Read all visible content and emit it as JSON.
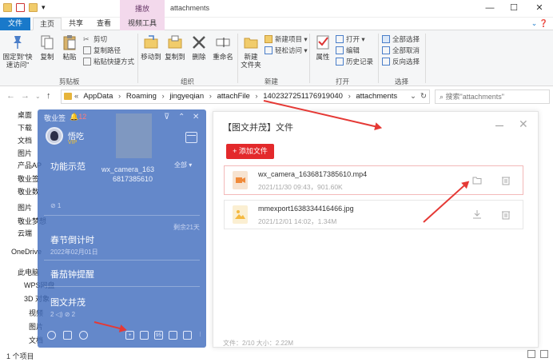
{
  "window": {
    "title": "attachments",
    "tools_header": "播放",
    "controls": [
      "—",
      "☐",
      "✕"
    ]
  },
  "ribbon_tabs": [
    "文件",
    "主页",
    "共享",
    "查看",
    "视频工具"
  ],
  "ribbon": {
    "clipboard": {
      "pin": "固定到\"快速访问\"",
      "copy": "复制",
      "paste": "粘贴",
      "cut": "剪切",
      "copy_path": "复制路径",
      "paste_shortcut": "粘贴快捷方式",
      "label": "剪贴板"
    },
    "organize": {
      "move_to": "移动到",
      "copy_to": "复制到",
      "delete": "删除",
      "rename": "重命名",
      "label": "组织"
    },
    "new": {
      "new_folder": "新建\n文件夹",
      "new_item": "新建项目 ▾",
      "easy_access": "轻松访问 ▾",
      "label": "新建"
    },
    "open": {
      "properties": "属性",
      "open": "打开 ▾",
      "edit": "编辑",
      "history": "历史记录",
      "label": "打开"
    },
    "select": {
      "select_all": "全部选择",
      "select_none": "全部取消",
      "invert": "反向选择",
      "label": "选择"
    }
  },
  "address": {
    "crumbs": [
      "«",
      "AppData",
      "›",
      "Roaming",
      "›",
      "jingyeqian",
      "›",
      "attachFile",
      "›",
      "1402327251176919040",
      "›",
      "attachments"
    ],
    "search_placeholder": "搜索\"attachments\""
  },
  "navpane": [
    "桌面",
    "下载",
    "文档",
    "图片",
    "产品AP",
    "敬业签",
    "敬业数",
    "图片",
    "敬业梦想",
    "云端",
    "OneDrive",
    "此电脑",
    "WPS网盘",
    "3D 对象",
    "视频",
    "图片",
    "文档"
  ],
  "statusbar": {
    "count": "1 个项目"
  },
  "sticky": {
    "app_name": "敬业签",
    "count": "12",
    "user": "悟吃",
    "vip": "VIP",
    "filter": "全部 ▾",
    "thumb_caption_1": "wx_camera_163",
    "thumb_caption_2": "6817385610",
    "notes": [
      {
        "title": "功能示范",
        "meta": "",
        "extra": ""
      },
      {
        "title": "",
        "meta": "⊘ 1",
        "extra": ""
      },
      {
        "title": "春节倒计时",
        "meta": "2022年02月01日",
        "extra": "剩余21天"
      },
      {
        "title": "番茄钟提醒",
        "meta": "",
        "extra": ""
      },
      {
        "title": "图文并茂",
        "meta": "2  ◁)  ⊘ 2",
        "extra": ""
      }
    ],
    "bottom_icons": [
      "clock-icon",
      "calendar-icon",
      "search-icon",
      "add-icon",
      "grid-icon",
      "note95-icon",
      "list-icon",
      "more-icon"
    ]
  },
  "dialog": {
    "title": "【图文并茂】文件",
    "add_button": "+ 添加文件",
    "files": [
      {
        "name": "wx_camera_1636817385610.mp4",
        "meta": "2021/11/30 09:43，901.60K",
        "type": "video"
      },
      {
        "name": "mmexport1638334416466.jpg",
        "meta": "2021/12/01 14:02，1.34M",
        "type": "image"
      }
    ],
    "footer": "文件：2/10    大小：2.22M"
  },
  "colors": {
    "accent_blue": "#1979ca",
    "sticky_blue": "#426ebe",
    "red": "#e3292b",
    "video_orange": "#f08a3a",
    "image_yellow": "#f5b940"
  }
}
